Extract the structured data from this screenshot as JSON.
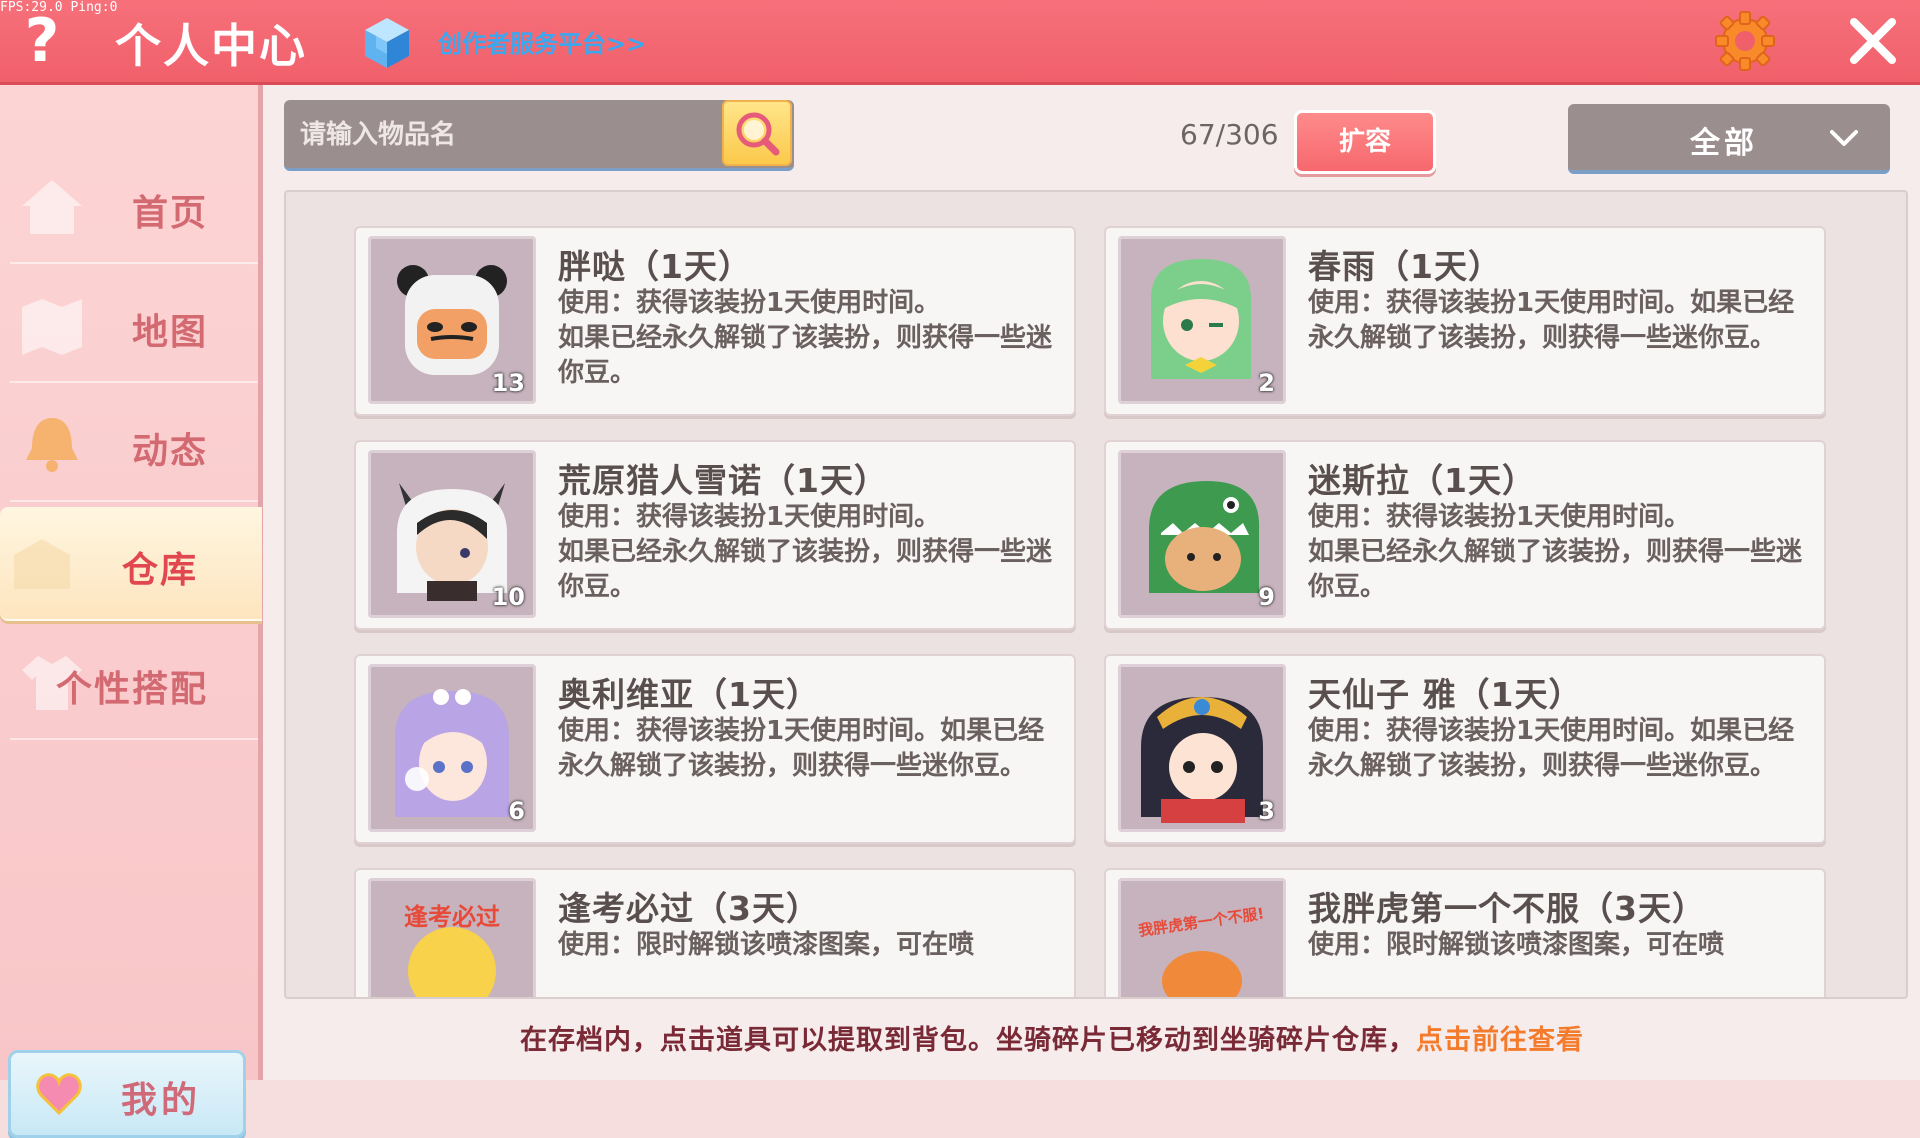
{
  "debug": {
    "fps_text": "FPS:29.0  Ping:0"
  },
  "header": {
    "title": "个人中心",
    "platform_link": "创作者服务平台>>",
    "accent_color": "#f0606b",
    "help_icon": "question-mark-icon",
    "settings_icon": "gear-icon",
    "close_icon": "close-icon"
  },
  "sidebar": {
    "items": [
      {
        "label": "首页",
        "icon": "home-icon",
        "active": false
      },
      {
        "label": "地图",
        "icon": "map-icon",
        "active": false
      },
      {
        "label": "动态",
        "icon": "bell-icon",
        "active": false
      },
      {
        "label": "仓库",
        "icon": "warehouse-icon",
        "active": true
      },
      {
        "label": "个性搭配",
        "icon": "outfit-icon",
        "active": false
      }
    ],
    "mine_button": {
      "label": "我的",
      "icon": "heart-icon"
    }
  },
  "toolbar": {
    "search_placeholder": "请输入物品名",
    "capacity": "67/306",
    "expand_label": "扩容",
    "filter_selected": "全部"
  },
  "items": [
    {
      "name": "胖哒（1天）",
      "desc": "使用：获得该装扮1天使用时间。\n  如果已经永久解锁了该装扮，则获得一些迷你豆。",
      "count": "13",
      "icon": "panda-avatar"
    },
    {
      "name": "春雨（1天）",
      "desc": "使用：获得该装扮1天使用时间。如果已经永久解锁了该装扮，则获得一些迷你豆。",
      "count": "2",
      "icon": "green-hair-girl-avatar"
    },
    {
      "name": "荒原猎人雪诺（1天）",
      "desc": "使用：获得该装扮1天使用时间。\n  如果已经永久解锁了该装扮，则获得一些迷你豆。",
      "count": "10",
      "icon": "wolf-hood-hunter-avatar"
    },
    {
      "name": "迷斯拉（1天）",
      "desc": "使用：获得该装扮1天使用时间。\n  如果已经永久解锁了该装扮，则获得一些迷你豆。",
      "count": "9",
      "icon": "dino-hood-avatar"
    },
    {
      "name": "奥利维亚（1天）",
      "desc": "使用：获得该装扮1天使用时间。如果已经永久解锁了该装扮，则获得一些迷你豆。",
      "count": "6",
      "icon": "purple-hair-girl-avatar"
    },
    {
      "name": "天仙子 雅（1天）",
      "desc": "使用：获得该装扮1天使用时间。如果已经永久解锁了该装扮，则获得一些迷你豆。",
      "count": "3",
      "icon": "opera-girl-avatar"
    },
    {
      "name": "逢考必过（3天）",
      "desc": "使用：限时解锁该喷漆图案，可在喷",
      "count": "",
      "icon": "exam-spray-icon",
      "thumb_text": "逢考必过"
    },
    {
      "name": "我胖虎第一个不服（3天）",
      "desc": "使用：限时解锁该喷漆图案，可在喷",
      "count": "",
      "icon": "tiger-spray-icon",
      "thumb_text": "我胖虎第一个不服!"
    }
  ],
  "footer": {
    "note": "在存档内，点击道具可以提取到背包。坐骑碎片已移动到坐骑碎片仓库，",
    "link": "点击前往查看"
  }
}
